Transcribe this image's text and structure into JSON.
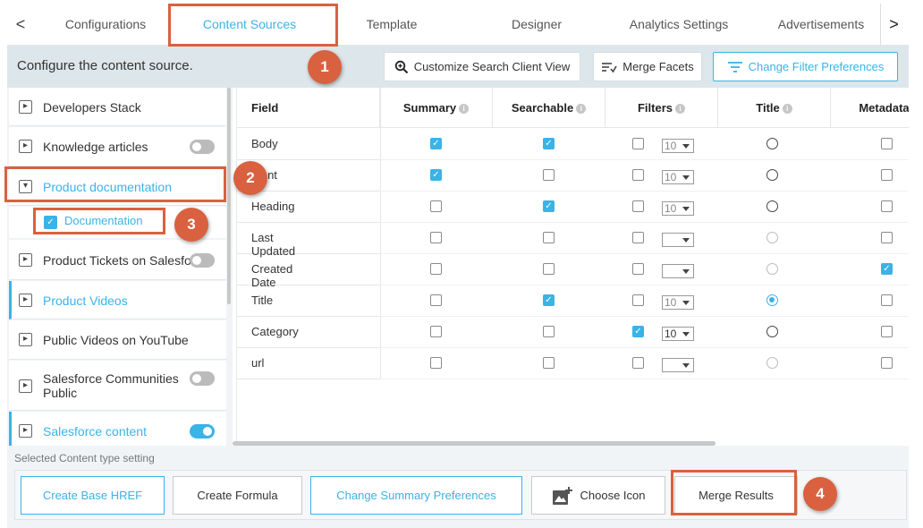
{
  "tabs": {
    "left_arrow": "<",
    "right_arrow": ">",
    "items": [
      "Configurations",
      "Content Sources",
      "Template",
      "Designer",
      "Analytics Settings",
      "Advertisements"
    ]
  },
  "header": {
    "text": "Configure the content source.",
    "customize_search_client_view": "Customize Search Client View",
    "merge_facets": "Merge Facets",
    "change_filter_preferences": "Change Filter Preferences"
  },
  "sidebar": {
    "items": [
      {
        "label": "Developers Stack"
      },
      {
        "label": "Knowledge articles",
        "toggle": "off"
      },
      {
        "label": "Product documentation",
        "expanded": true
      },
      {
        "label": "Documentation",
        "checked": true
      },
      {
        "label": "Product Tickets on Salesfo",
        "toggle": "off"
      },
      {
        "label": "Product Videos"
      },
      {
        "label": "Public Videos on YouTube"
      },
      {
        "label": "Salesforce Communities Public",
        "toggle": "off"
      },
      {
        "label": "Salesforce content",
        "toggle": "on"
      }
    ]
  },
  "table": {
    "headers": [
      "Field",
      "Summary",
      "Searchable",
      "Filters",
      "Title",
      "Metadata"
    ],
    "rows": [
      {
        "field": "Body",
        "summary": true,
        "searchable": true,
        "filter": false,
        "filter_value": "10",
        "title": "empty",
        "metadata": false
      },
      {
        "field": "ntent",
        "summary": true,
        "searchable": false,
        "filter": false,
        "filter_value": "10",
        "title": "empty",
        "metadata": false
      },
      {
        "field": "Heading",
        "summary": false,
        "searchable": true,
        "filter": false,
        "filter_value": "10",
        "title": "empty",
        "metadata": false
      },
      {
        "field": "Last Updated",
        "summary": false,
        "searchable": false,
        "filter": false,
        "filter_value": "",
        "title": "light",
        "metadata": false
      },
      {
        "field": "Created Date",
        "summary": false,
        "searchable": false,
        "filter": false,
        "filter_value": "",
        "title": "light",
        "metadata": true
      },
      {
        "field": "Title",
        "summary": false,
        "searchable": true,
        "filter": false,
        "filter_value": "10",
        "title": "selected",
        "metadata": false
      },
      {
        "field": "Category",
        "summary": false,
        "searchable": false,
        "filter": true,
        "filter_value": "10",
        "title": "empty",
        "metadata": false
      },
      {
        "field": "url",
        "summary": false,
        "searchable": false,
        "filter": false,
        "filter_value": "",
        "title": "light",
        "metadata": false
      }
    ]
  },
  "bottom": {
    "label": "Selected Content type setting",
    "create_base_href": "Create Base HREF",
    "create_formula": "Create Formula",
    "change_summary_preferences": "Change Summary Preferences",
    "choose_icon": "Choose Icon",
    "merge_results": "Merge Results"
  },
  "annotations": {
    "badge1": "1",
    "badge2": "2",
    "badge3": "3",
    "badge4": "4"
  },
  "colors": {
    "accent": "#3ab3e6",
    "annotation": "#d9613f",
    "header_bg": "#dde6ea"
  }
}
